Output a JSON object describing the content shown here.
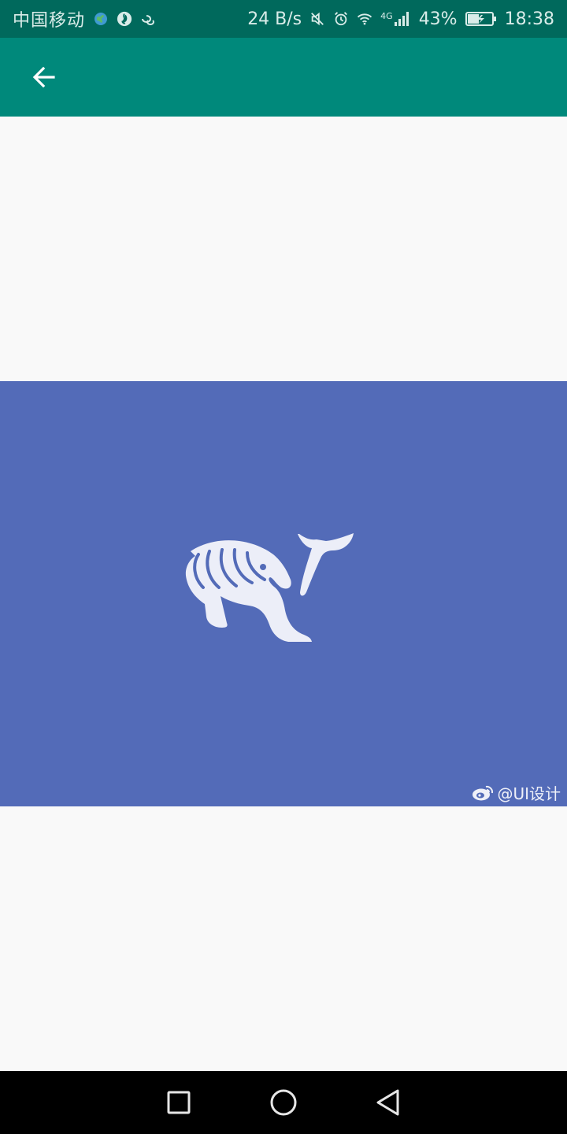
{
  "status_bar": {
    "carrier": "中国移动",
    "net_speed": "24 B/s",
    "network_type": "4G",
    "battery": "43%",
    "time": "18:38"
  },
  "watermark": {
    "text": "@UI设计"
  },
  "colors": {
    "status_bar": "#00695c",
    "app_bar": "#00897b",
    "image_background": "#536bb8",
    "page_background": "#f9f9f9",
    "nav_bar": "#000000"
  },
  "icons": {
    "back": "arrow-left-icon",
    "overview": "square-icon",
    "home": "circle-icon",
    "nav_back": "triangle-back-icon"
  }
}
